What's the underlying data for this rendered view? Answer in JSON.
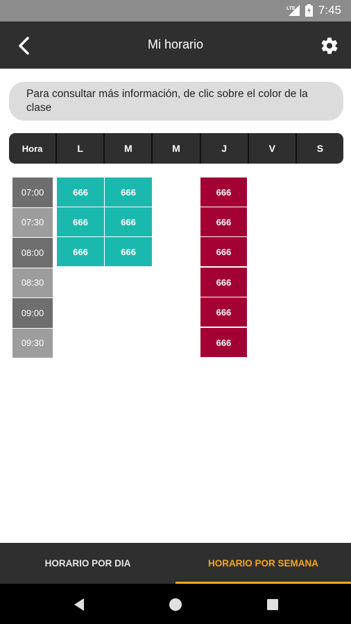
{
  "status_bar": {
    "time": "7:45",
    "network": "LTE"
  },
  "app_bar": {
    "title": "Mi horario"
  },
  "info": {
    "text": "Para consultar más información, de clic sobre el color de la clase"
  },
  "days": [
    "Hora",
    "L",
    "M",
    "M",
    "J",
    "V",
    "S"
  ],
  "hours": [
    "07:00",
    "07:30",
    "08:00",
    "08:30",
    "09:00",
    "09:30"
  ],
  "classes": {
    "lunes": [
      "666",
      "666",
      "666"
    ],
    "martes": [
      "666",
      "666",
      "666"
    ],
    "jueves": [
      "666",
      "666",
      "666",
      "666",
      "666",
      "666"
    ]
  },
  "tabs": {
    "day": "HORARIO POR DIA",
    "week": "HORARIO POR SEMANA"
  },
  "colors": {
    "teal": "#1bb9ad",
    "maroon": "#a30034",
    "accent": "#f5a623"
  }
}
